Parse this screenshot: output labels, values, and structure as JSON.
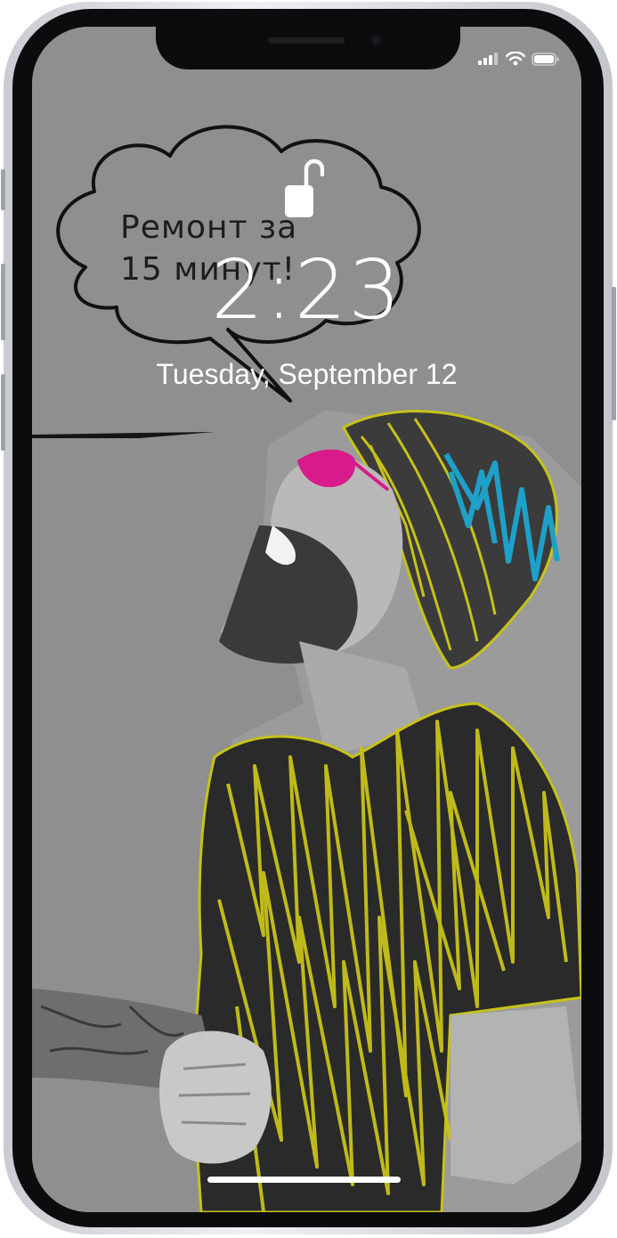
{
  "lockscreen": {
    "time": "2:23",
    "date": "Tuesday, September 12"
  },
  "wallpaper": {
    "speech_bubble_text": "Ремонт за\n15 минут!",
    "colors": {
      "background": "#8e8e8e",
      "scribble_yellow": "#c7c21a",
      "glasses_magenta": "#d81b8a",
      "hat_blue": "#1ea0c8"
    }
  },
  "status_bar": {
    "icons": [
      "cellular-signal-icon",
      "wifi-icon",
      "battery-icon"
    ]
  },
  "icons": {
    "lock": "unlocked-padlock-icon"
  }
}
